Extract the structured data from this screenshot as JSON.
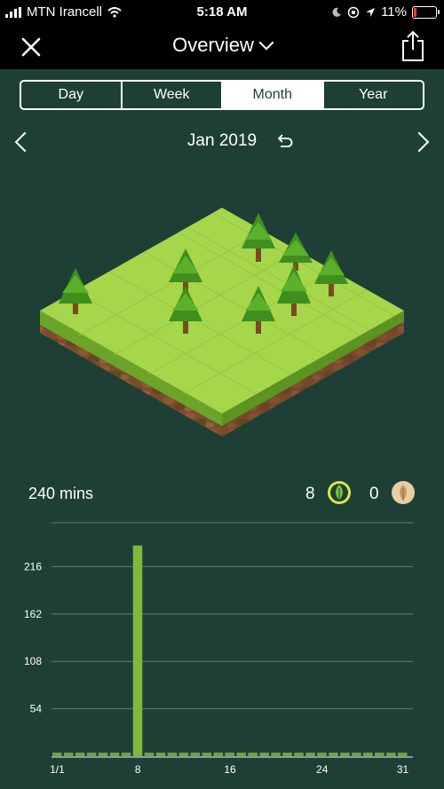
{
  "status_bar": {
    "carrier": "MTN Irancell",
    "time": "5:18 AM",
    "battery": "11%"
  },
  "nav": {
    "title": "Overview"
  },
  "tabs": [
    {
      "label": "Day",
      "active": false
    },
    {
      "label": "Week",
      "active": false
    },
    {
      "label": "Month",
      "active": true
    },
    {
      "label": "Year",
      "active": false
    }
  ],
  "period": {
    "label": "Jan 2019"
  },
  "summary": {
    "total_time": "240 mins",
    "healthy_trees": "8",
    "withered_trees": "0"
  },
  "colors": {
    "background": "#1e3f36",
    "bar": "#7fb93a",
    "leaf_live": "#d7e84a",
    "leaf_dead": "#e6cfa4"
  },
  "chart_data": {
    "type": "bar",
    "x": [
      1,
      2,
      3,
      4,
      5,
      6,
      7,
      8,
      9,
      10,
      11,
      12,
      13,
      14,
      15,
      16,
      17,
      18,
      19,
      20,
      21,
      22,
      23,
      24,
      25,
      26,
      27,
      28,
      29,
      30,
      31
    ],
    "values": [
      0,
      0,
      0,
      0,
      0,
      0,
      0,
      240,
      0,
      0,
      0,
      0,
      0,
      0,
      0,
      0,
      0,
      0,
      0,
      0,
      0,
      0,
      0,
      0,
      0,
      0,
      0,
      0,
      0,
      0,
      0
    ],
    "x_tick_labels": [
      "1/1",
      "8",
      "16",
      "24",
      "31"
    ],
    "x_tick_days": [
      1,
      8,
      16,
      24,
      31
    ],
    "y_ticks": [
      54,
      108,
      162,
      216
    ],
    "ylim": [
      0,
      270
    ],
    "grid": true
  }
}
